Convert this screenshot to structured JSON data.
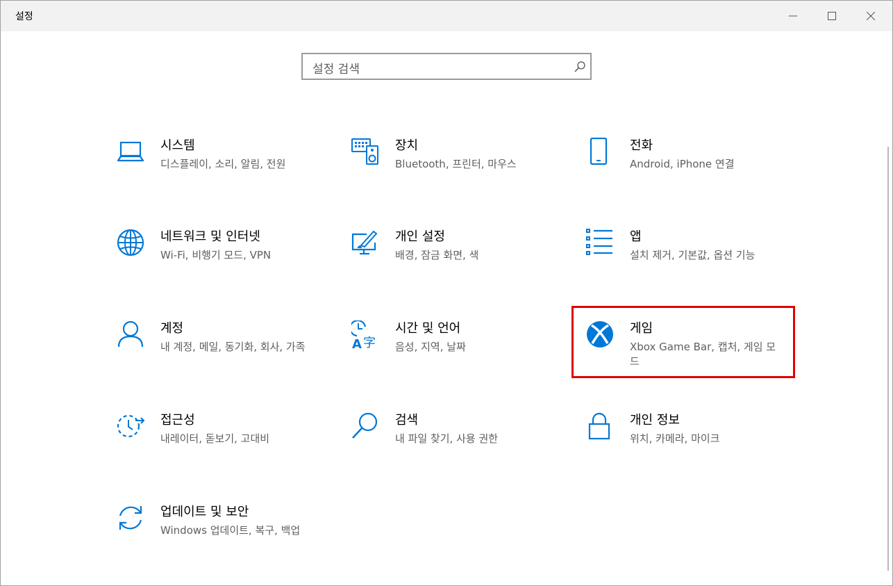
{
  "window": {
    "title": "설정",
    "controls": {
      "minimize_icon": "minimize-icon",
      "maximize_icon": "maximize-icon",
      "close_icon": "close-icon"
    }
  },
  "search": {
    "placeholder": "설정 검색",
    "icon": "search-icon"
  },
  "highlight_color": "#e00000",
  "accent_color": "#0078d7",
  "items": [
    {
      "name": "시스템",
      "desc": "디스플레이, 소리, 알림, 전원",
      "icon": "laptop-icon"
    },
    {
      "name": "장치",
      "desc": "Bluetooth, 프린터, 마우스",
      "icon": "devices-icon"
    },
    {
      "name": "전화",
      "desc": "Android, iPhone 연결",
      "icon": "phone-icon"
    },
    {
      "name": "네트워크 및 인터넷",
      "desc": "Wi-Fi, 비행기 모드, VPN",
      "icon": "globe-icon"
    },
    {
      "name": "개인 설정",
      "desc": "배경, 잠금 화면, 색",
      "icon": "personalization-icon"
    },
    {
      "name": "앱",
      "desc": "설치 제거, 기본값, 옵션 기능",
      "icon": "apps-list-icon"
    },
    {
      "name": "계정",
      "desc": "내 계정, 메일, 동기화, 회사, 가족",
      "icon": "person-icon"
    },
    {
      "name": "시간 및 언어",
      "desc": "음성, 지역, 날짜",
      "icon": "time-language-icon"
    },
    {
      "name": "게임",
      "desc": "Xbox Game Bar, 캡처, 게임 모드",
      "icon": "xbox-icon"
    },
    {
      "name": "접근성",
      "desc": "내레이터, 돋보기, 고대비",
      "icon": "ease-of-access-icon"
    },
    {
      "name": "검색",
      "desc": "내 파일 찾기, 사용 권한",
      "icon": "search-magnifier-icon"
    },
    {
      "name": "개인 정보",
      "desc": "위치, 카메라, 마이크",
      "icon": "lock-icon"
    },
    {
      "name": "업데이트 및 보안",
      "desc": "Windows 업데이트, 복구, 백업",
      "icon": "sync-icon"
    }
  ]
}
